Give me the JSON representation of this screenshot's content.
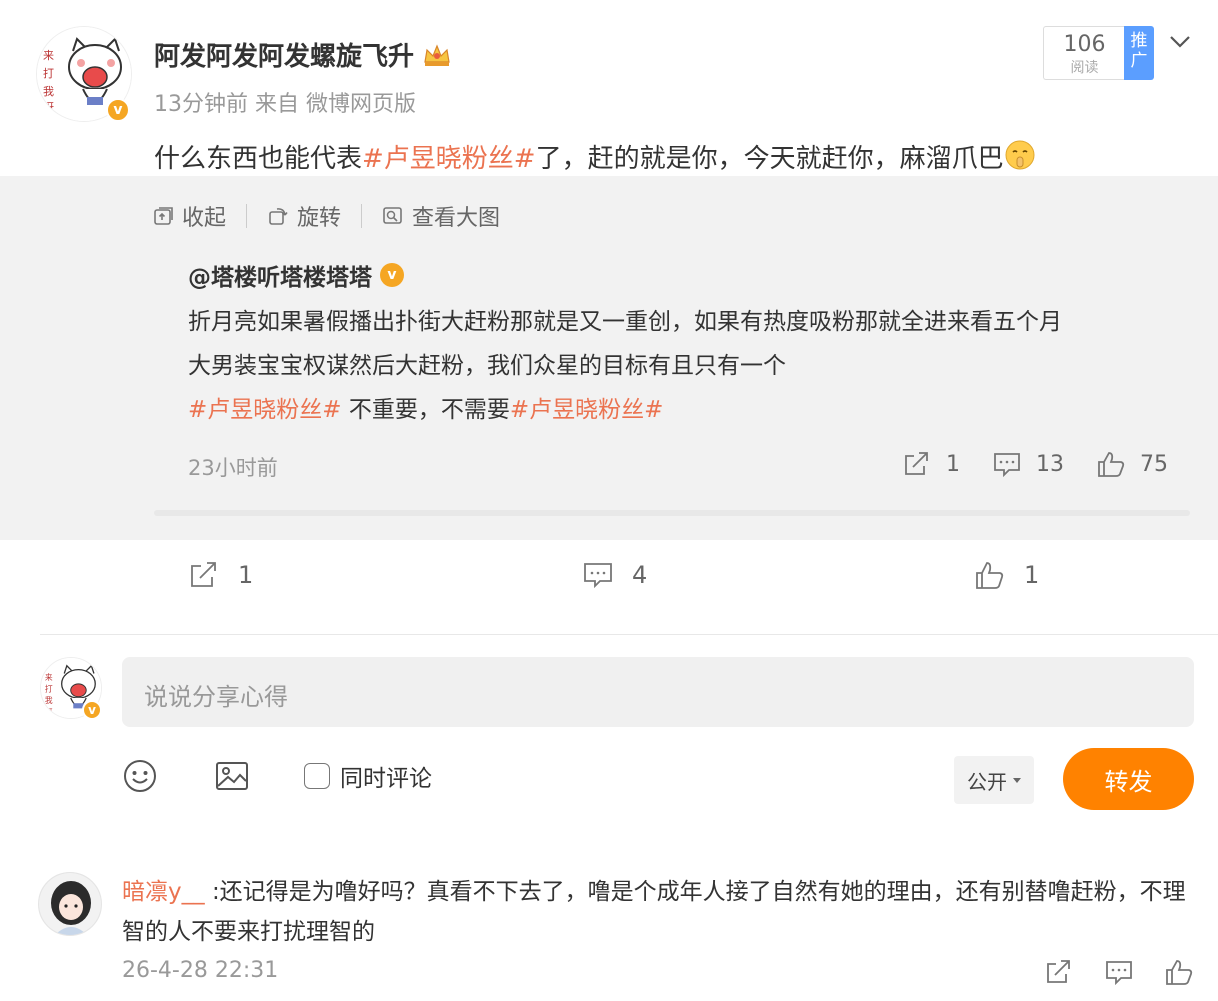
{
  "post": {
    "author": "阿发阿发阿发螺旋飞升",
    "meta": "13分钟前 来自 微博网页版",
    "read_count": "106",
    "read_label": "阅读",
    "promo_label": "推广",
    "text_before": "什么东西也能代表",
    "hashtag": "#卢昱晓粉丝#",
    "text_after": "了，赶的就是你，今天就赶你，麻溜爪巴"
  },
  "repost_tools": {
    "collapse": "收起",
    "rotate": "旋转",
    "view_large": "查看大图"
  },
  "original": {
    "author": "@塔楼听塔楼塔塔",
    "text_line1": "折月亮如果暑假播出扑街大赶粉那就是又一重创，如果有热度吸粉那就全进来看五个月",
    "text_line2": "大男装宝宝权谋然后大赶粉，我们众星的目标有且只有一个",
    "hashtag1": "#卢昱晓粉丝#",
    "text_line3_mid": " 不重要，不需要",
    "hashtag2": "#卢昱晓粉丝#",
    "time": "23小时前",
    "reposts": "1",
    "comments": "13",
    "likes": "75"
  },
  "actions": {
    "reposts": "1",
    "comments": "4",
    "likes": "1"
  },
  "composer": {
    "placeholder": "说说分享心得",
    "also_comment": "同时评论",
    "visibility": "公开",
    "submit": "转发"
  },
  "comment": {
    "user": "暗凛y__",
    "text": ":还记得是为噜好吗？真看不下去了，噜是个成年人接了自然有她的理由，还有别替噜赶粉，不理智的人不要来打扰理智的",
    "time": "26-4-28 22:31"
  },
  "colors": {
    "accent": "#ff8200",
    "hashtag": "#eb7350",
    "promo": "#5b9eff",
    "verified": "#f5a623"
  }
}
